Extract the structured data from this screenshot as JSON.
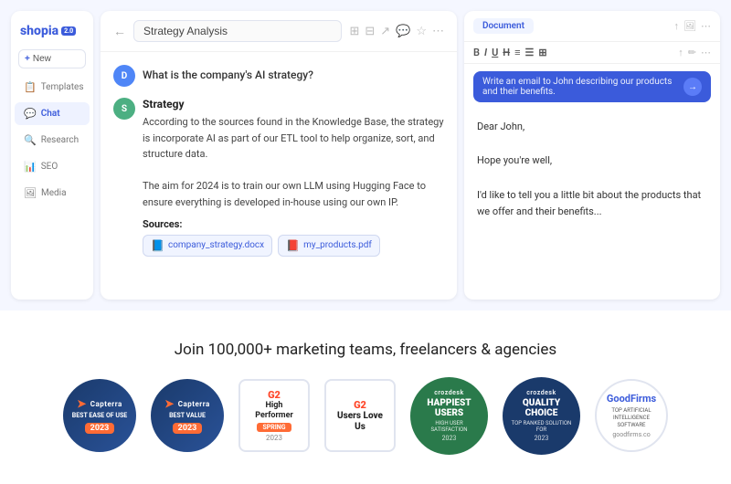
{
  "app": {
    "logo": "shopia",
    "logo_badge": "2.0",
    "new_button": "+ New"
  },
  "sidebar": {
    "items": [
      {
        "id": "templates",
        "label": "Templates",
        "icon": "📋"
      },
      {
        "id": "chat",
        "label": "Chat",
        "icon": "💬",
        "active": true
      },
      {
        "id": "research",
        "label": "Research",
        "icon": "🔍"
      },
      {
        "id": "seo",
        "label": "SEO",
        "icon": "📊"
      },
      {
        "id": "media",
        "label": "Media",
        "icon": "🖼"
      }
    ]
  },
  "chat": {
    "title": "Strategy Analysis",
    "question": "What is the company's AI strategy?",
    "answer_title": "Strategy",
    "answer_body": "According to the sources found in the Knowledge Base, the strategy is incorporate AI as part of our ETL tool to help organize, sort, and structure data.\n\nThe aim for 2024 is to train our own LLM using Hugging Face to ensure everything is developed in-house using our own IP.",
    "sources_label": "Sources:",
    "sources": [
      {
        "label": "company_strategy.docx",
        "icon": "📘"
      },
      {
        "label": "my_products.pdf",
        "icon": "📕"
      }
    ]
  },
  "document": {
    "tab_label": "Document",
    "ai_prompt_placeholder": "Write an email to John describing our products and their benefits.",
    "content_line1": "Dear John,",
    "content_line2": "Hope you're well,",
    "content_line3": "I'd like to tell you a little bit about the products that we offer and their benefits..."
  },
  "footer": {
    "join_text": "Join 100,000+ marketing teams, freelancers & agencies",
    "badges": [
      {
        "id": "capterra-ease",
        "type": "capterra",
        "label": "BEST EASE OF USE",
        "year": "2023"
      },
      {
        "id": "capterra-value",
        "type": "capterra",
        "label": "BEST VALUE",
        "year": "2023"
      },
      {
        "id": "g2-performer",
        "type": "g2-performer",
        "title": "High Performer",
        "season": "SPRING",
        "year": "2023"
      },
      {
        "id": "g2-users-love",
        "type": "g2-users-love",
        "title": "Users Love Us"
      },
      {
        "id": "happiest-users",
        "type": "happiest",
        "brand": "crozdesk",
        "title": "HAPPIEST USERS",
        "subtitle": "HIGH USER SATISFACTION",
        "year": "2023"
      },
      {
        "id": "quality-choice",
        "type": "quality",
        "brand": "crozdesk",
        "title": "QUALITY CHOICE",
        "subtitle": "TOP RANKED SOLUTION FOR",
        "year": "2023"
      },
      {
        "id": "goodfirms",
        "type": "goodfirms",
        "title": "GoodFirms",
        "label": "TOP ARTIFICIAL INTELLIGENCE SOFTWARE",
        "sub": "goodfirms.co"
      }
    ]
  }
}
